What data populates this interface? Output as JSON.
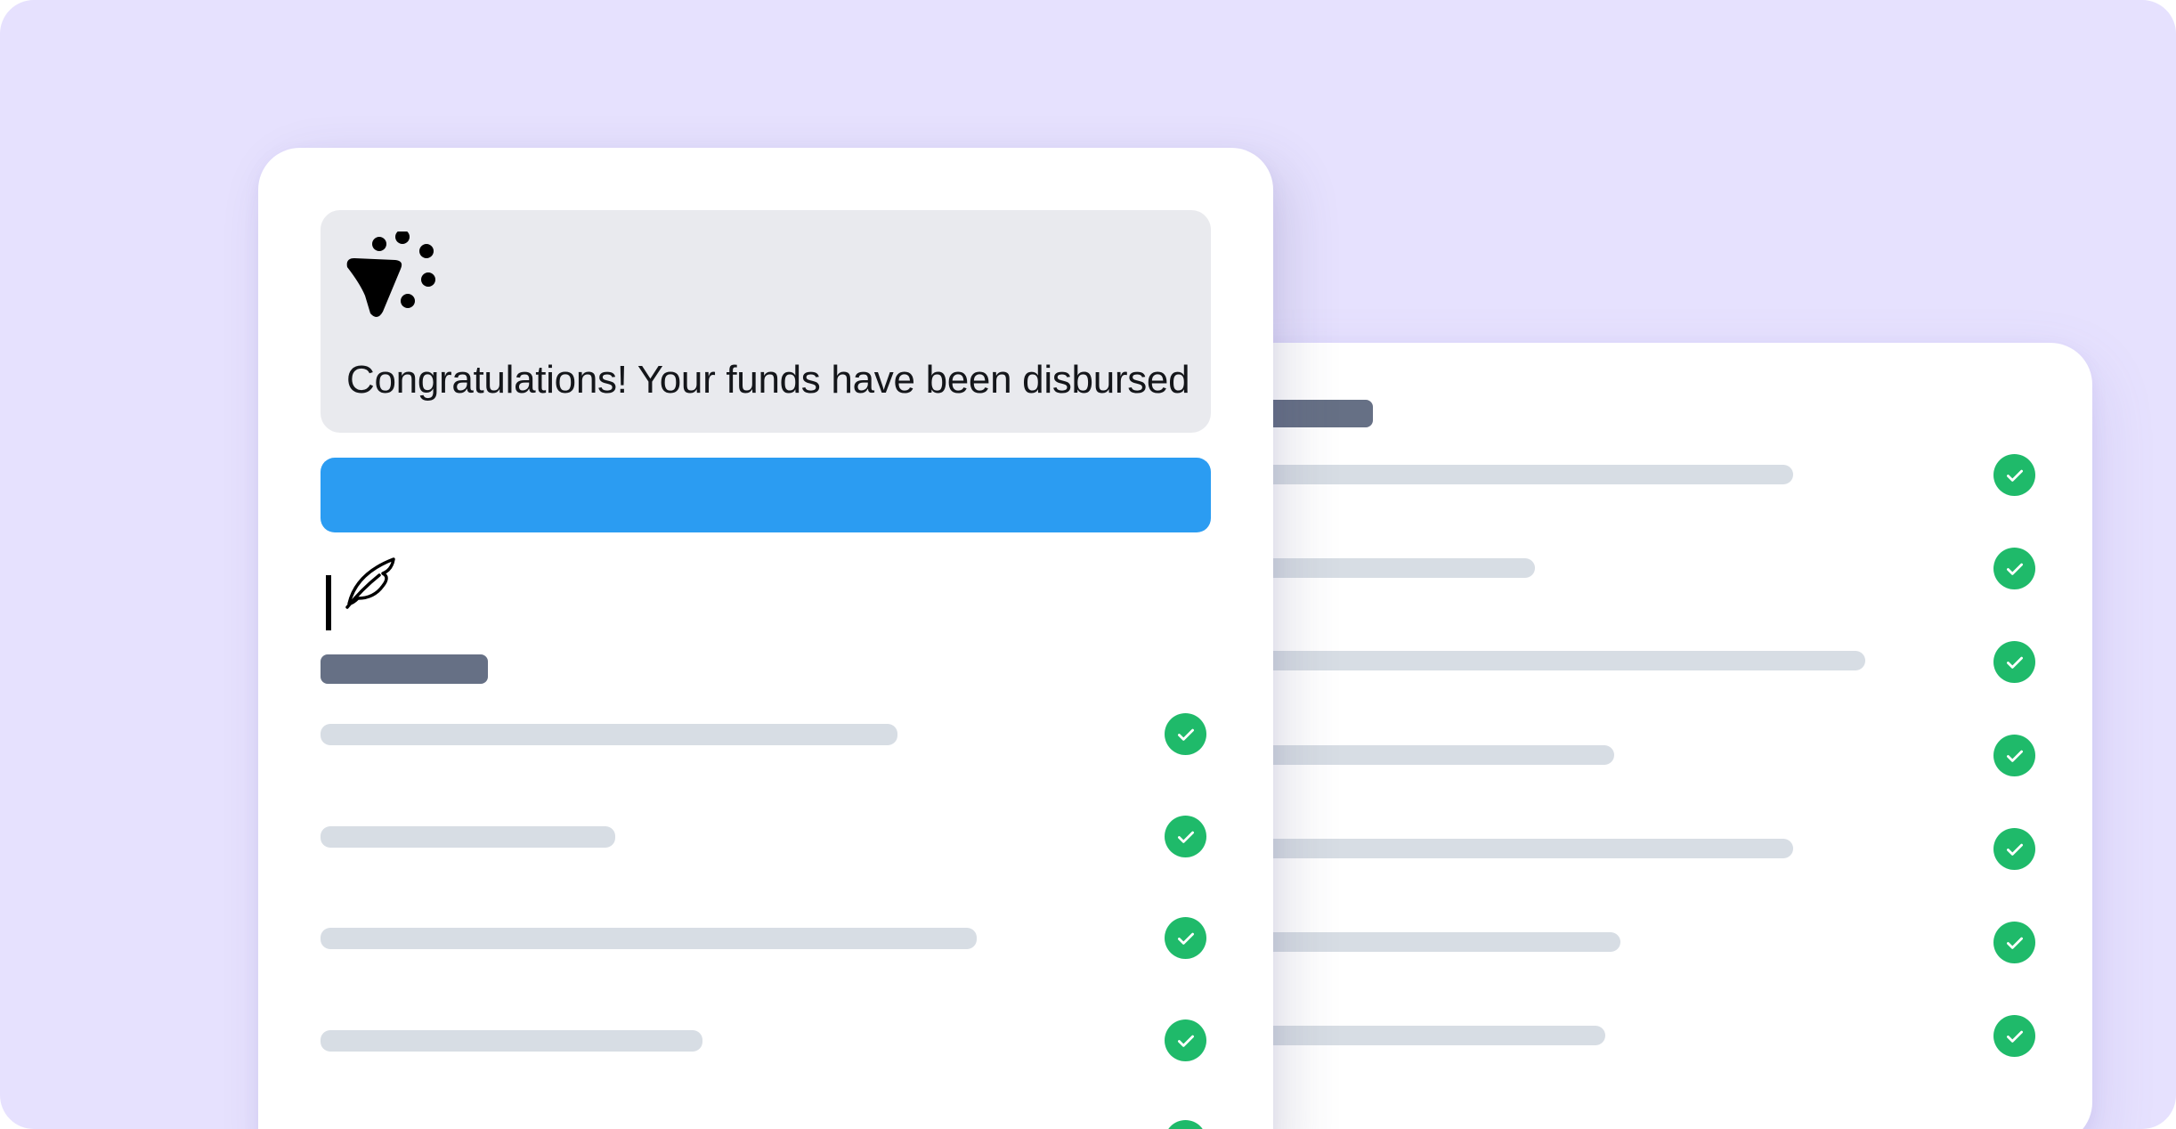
{
  "banner": {
    "message": "Congratulations! Your funds have been disbursed",
    "icon": "party-popper-icon"
  },
  "primary_action": {
    "label": "",
    "color": "#2b9cf2"
  },
  "signature_icon": "quill-signature-icon",
  "colors": {
    "background": "#e6e1fe",
    "success": "#1fba6a",
    "skeleton": "#d7dde4",
    "skeleton_heading": "#667085"
  },
  "front_checklist": {
    "completed_items": 5,
    "visible_items": 5
  },
  "back_checklist": {
    "completed_items": 7,
    "visible_items": 7
  }
}
